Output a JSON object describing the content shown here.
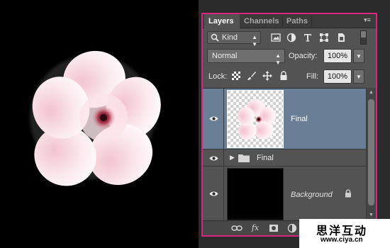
{
  "canvas": {
    "artwork": "flower-icon"
  },
  "layers_panel": {
    "tabs": [
      {
        "label": "Layers",
        "active": true
      },
      {
        "label": "Channels",
        "active": false
      },
      {
        "label": "Paths",
        "active": false
      }
    ],
    "menu_glyph": "▾≡",
    "filter": {
      "kind_label": "Kind",
      "icons": [
        "pixel-layer-filter-icon",
        "adjustment-layer-filter-icon",
        "type-layer-filter-icon",
        "shape-layer-filter-icon",
        "smart-object-filter-icon"
      ]
    },
    "blend_mode": "Normal",
    "opacity_label": "Opacity:",
    "opacity_value": "100%",
    "lock_label": "Lock:",
    "fill_label": "Fill:",
    "fill_value": "100%",
    "layers": [
      {
        "name": "Final",
        "type": "layer",
        "selected": true,
        "visible": true
      },
      {
        "name": "Final",
        "type": "group",
        "selected": false,
        "visible": true,
        "collapsed": true
      },
      {
        "name": "Background",
        "type": "background",
        "selected": false,
        "visible": true,
        "locked": true
      }
    ],
    "footer_icons": [
      "link-layers-icon",
      "fx-icon",
      "add-mask-icon",
      "adjustment-layer-icon"
    ],
    "footer_fx_label": "fx"
  },
  "watermark": {
    "text_cn": "思洋互动",
    "url": "www.ciya.cn"
  },
  "colors": {
    "panel_border": "#d9257b",
    "selected_row": "#6a7f95",
    "panel_bg": "#535353"
  }
}
